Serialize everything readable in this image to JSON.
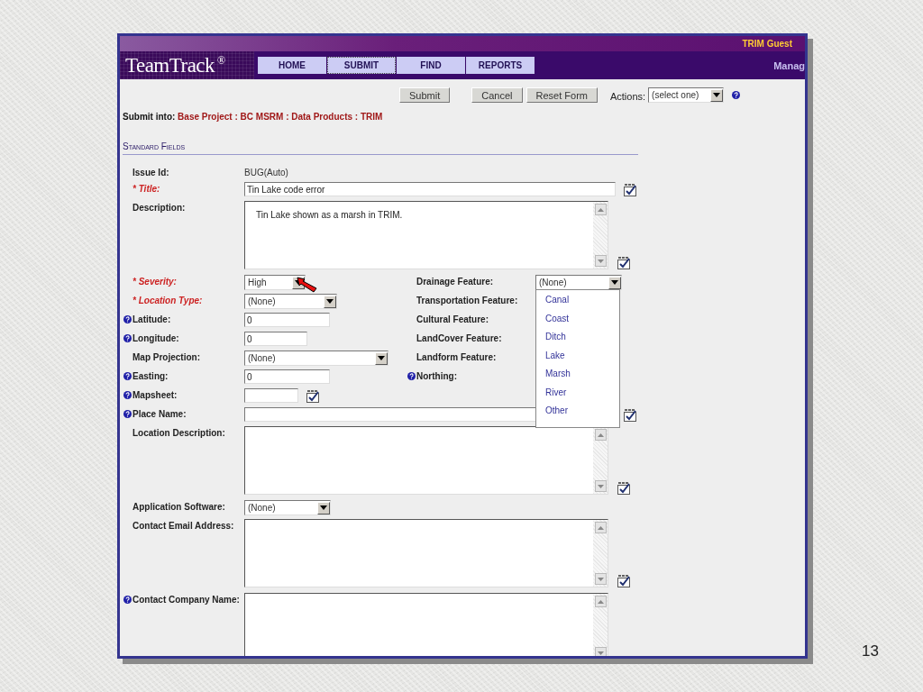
{
  "header": {
    "user": "TRIM Guest",
    "logo": "TeamTrack",
    "logo_mark": "®",
    "right_link": "Manag",
    "nav": [
      {
        "label": "HOME",
        "selected": false
      },
      {
        "label": "SUBMIT",
        "selected": true
      },
      {
        "label": "FIND",
        "selected": false
      },
      {
        "label": "REPORTS",
        "selected": false
      }
    ]
  },
  "toolbar": {
    "buttons": [
      "Submit",
      "Cancel",
      "Reset Form"
    ],
    "actions_label": "Actions:",
    "actions_value": "(select one)"
  },
  "submit_into": {
    "label": "Submit into:",
    "path": "Base Project : BC MSRM : Data Products : TRIM"
  },
  "section_title": "Standard Fields",
  "fields": [
    {
      "label": "Issue Id:",
      "kind": "static",
      "value": "BUG(Auto)",
      "required": false,
      "help": false,
      "spellcheck": false
    },
    {
      "label": "* Title:",
      "kind": "text",
      "value": "Tin Lake code error",
      "required": true,
      "help": false,
      "spellcheck": true
    },
    {
      "label": "Description:",
      "kind": "textarea",
      "value": "Tin Lake shown as a marsh in TRIM.",
      "required": false,
      "help": false,
      "spellcheck": true
    },
    {
      "label": "* Severity:",
      "kind": "select",
      "value": "High",
      "required": true,
      "help": false,
      "spellcheck": false,
      "pointer": true,
      "right": {
        "label": "Drainage Feature:",
        "help": false,
        "field": {
          "kind": "select",
          "value": "(None)",
          "expanded": true,
          "options": [
            "Canal",
            "Coast",
            "Ditch",
            "Lake",
            "Marsh",
            "River",
            "Other"
          ]
        }
      }
    },
    {
      "label": "* Location Type:",
      "kind": "select",
      "value": "(None)",
      "required": true,
      "help": false,
      "spellcheck": false,
      "right": {
        "label": "Transportation Feature:",
        "help": false
      }
    },
    {
      "label": "Latitude:",
      "kind": "text",
      "value": "0",
      "required": false,
      "help": true,
      "spellcheck": false,
      "right": {
        "label": "Cultural Feature:",
        "help": false
      }
    },
    {
      "label": "Longitude:",
      "kind": "text",
      "value": "0",
      "required": false,
      "help": true,
      "spellcheck": false,
      "right": {
        "label": "LandCover Feature:",
        "help": false
      }
    },
    {
      "label": "Map Projection:",
      "kind": "select",
      "value": "(None)",
      "required": false,
      "help": false,
      "spellcheck": false,
      "right": {
        "label": "Landform Feature:",
        "help": false
      }
    },
    {
      "label": "Easting:",
      "kind": "text",
      "value": "0",
      "required": false,
      "help": true,
      "spellcheck": false,
      "right": {
        "label": "Northing:",
        "help": true
      }
    },
    {
      "label": "Mapsheet:",
      "kind": "text",
      "required": false,
      "help": true,
      "spellcheck": true
    },
    {
      "label": "Place Name:",
      "kind": "text",
      "required": false,
      "help": true,
      "spellcheck": true
    },
    {
      "label": "Location Description:",
      "kind": "textarea",
      "required": false,
      "help": false,
      "spellcheck": true
    },
    {
      "label": "Application Software:",
      "kind": "select",
      "value": "(None)",
      "required": false,
      "help": false,
      "spellcheck": false
    },
    {
      "label": "Contact Email Address:",
      "kind": "textarea",
      "required": false,
      "help": false,
      "spellcheck": true
    },
    {
      "label": "Contact Company Name:",
      "kind": "textarea",
      "required": false,
      "help": true,
      "spellcheck": false
    }
  ],
  "slide_number": "13"
}
